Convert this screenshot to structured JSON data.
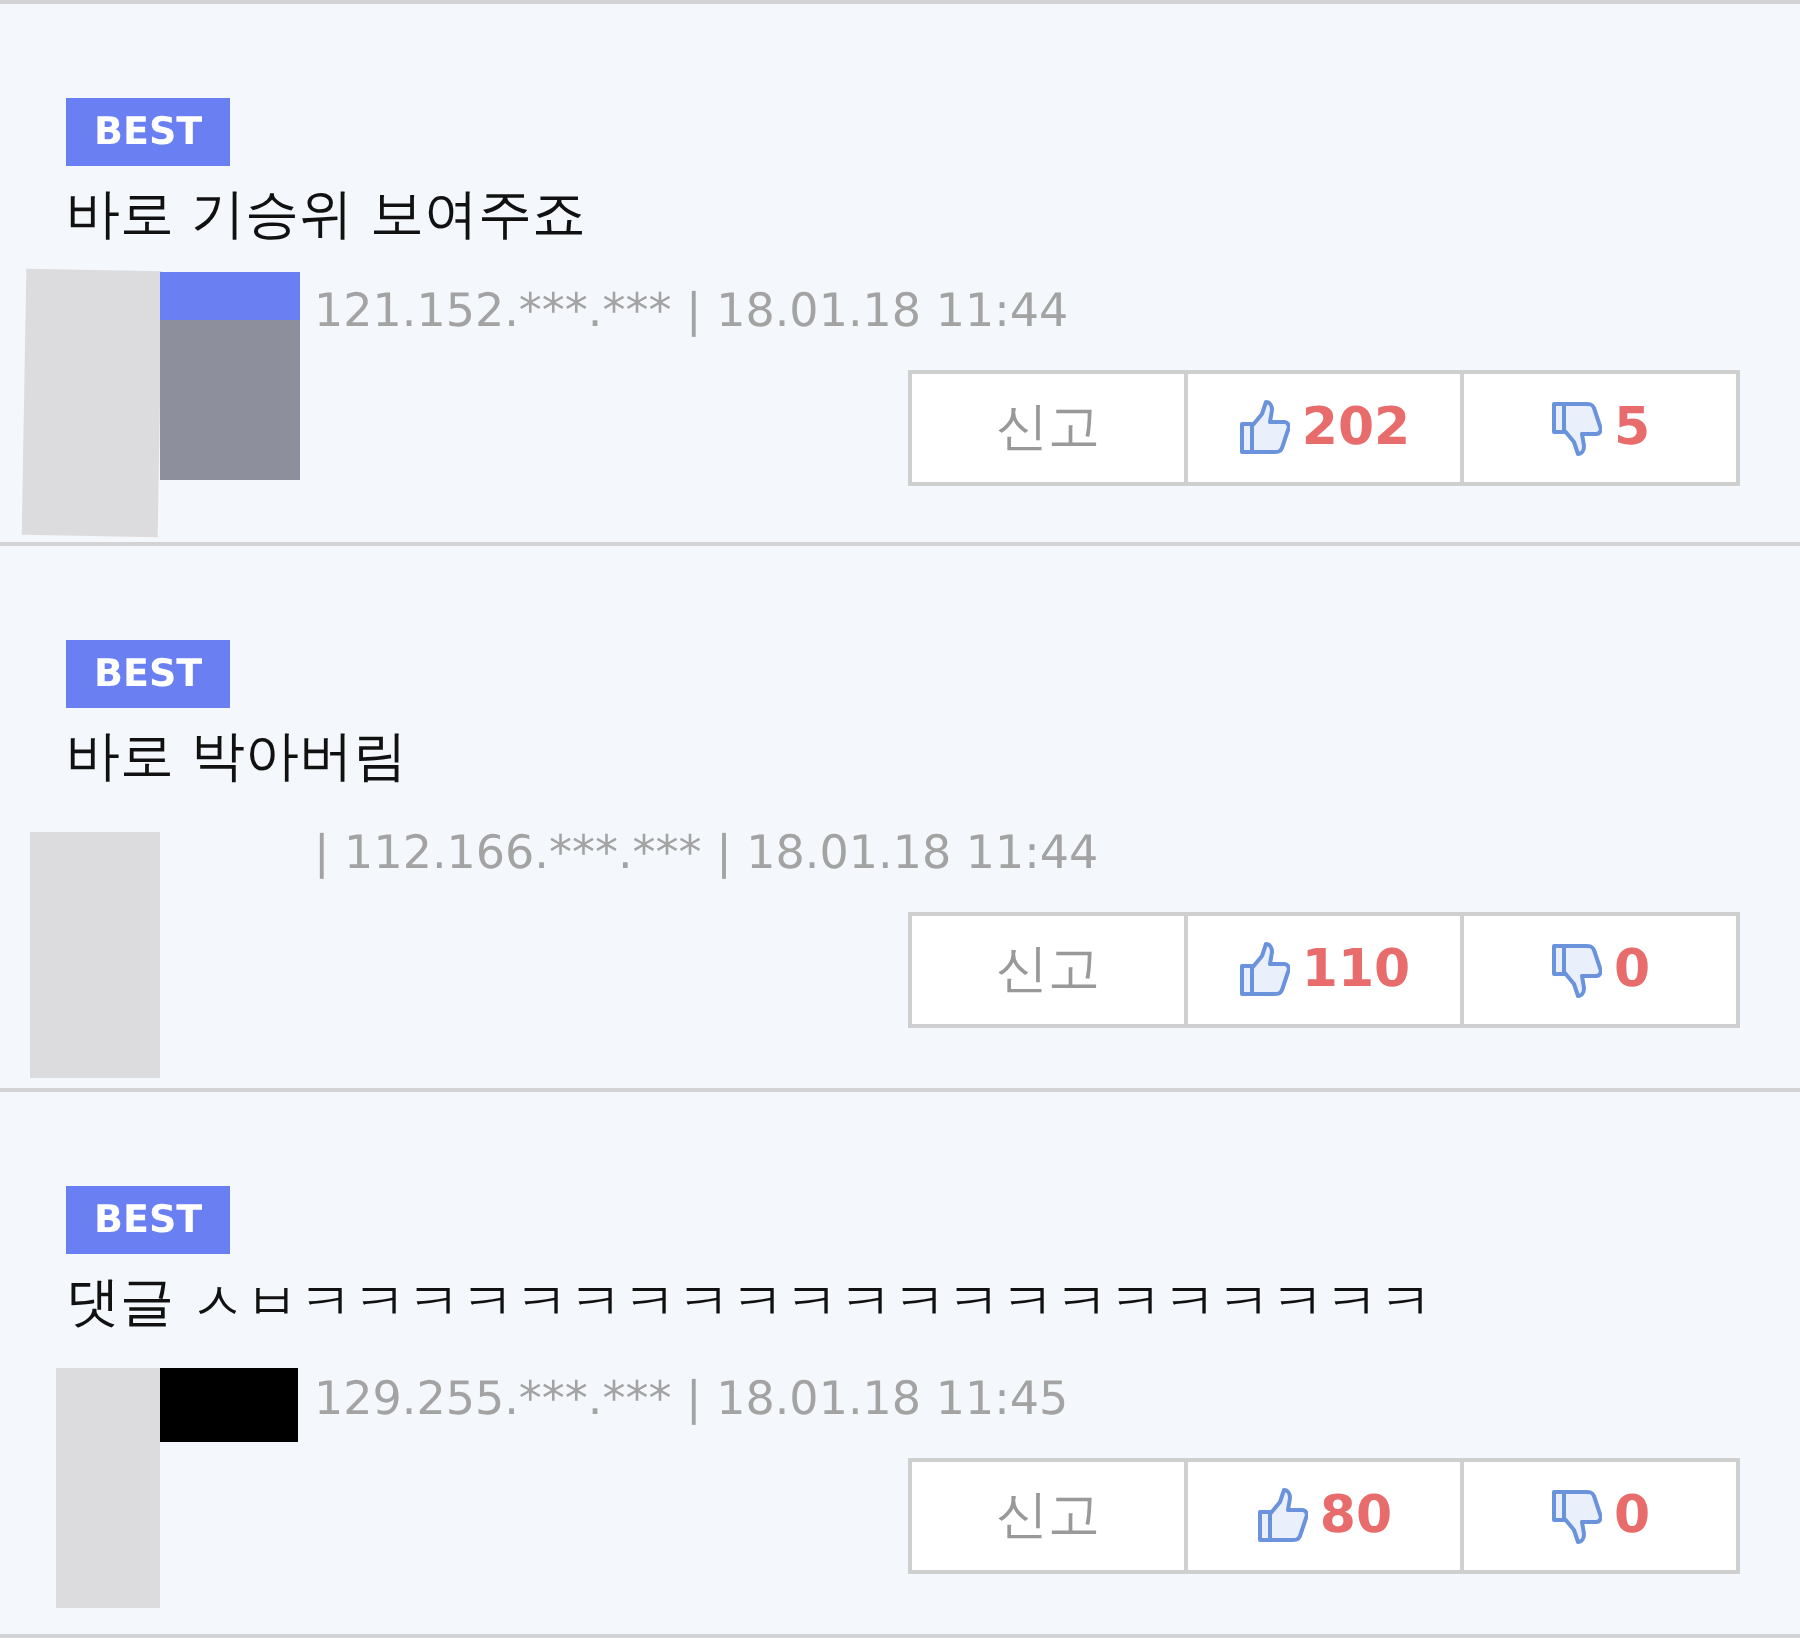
{
  "comments": [
    {
      "badge": "BEST",
      "text": "바로 기승위 보여주죠",
      "meta": "121.152.***.*** | 18.01.18 11:44",
      "report": "신고",
      "likes": "202",
      "dislikes": "5"
    },
    {
      "badge": "BEST",
      "text": "바로 박아버림",
      "meta": "| 112.166.***.*** | 18.01.18 11:44",
      "report": "신고",
      "likes": "110",
      "dislikes": "0"
    },
    {
      "badge": "BEST",
      "text": "댓글 ㅅㅂㅋㅋㅋㅋㅋㅋㅋㅋㅋㅋㅋㅋㅋㅋㅋㅋㅋㅋㅋㅋㅋ",
      "meta": "129.255.***.*** | 18.01.18 11:45",
      "report": "신고",
      "likes": "80",
      "dislikes": "0"
    }
  ]
}
